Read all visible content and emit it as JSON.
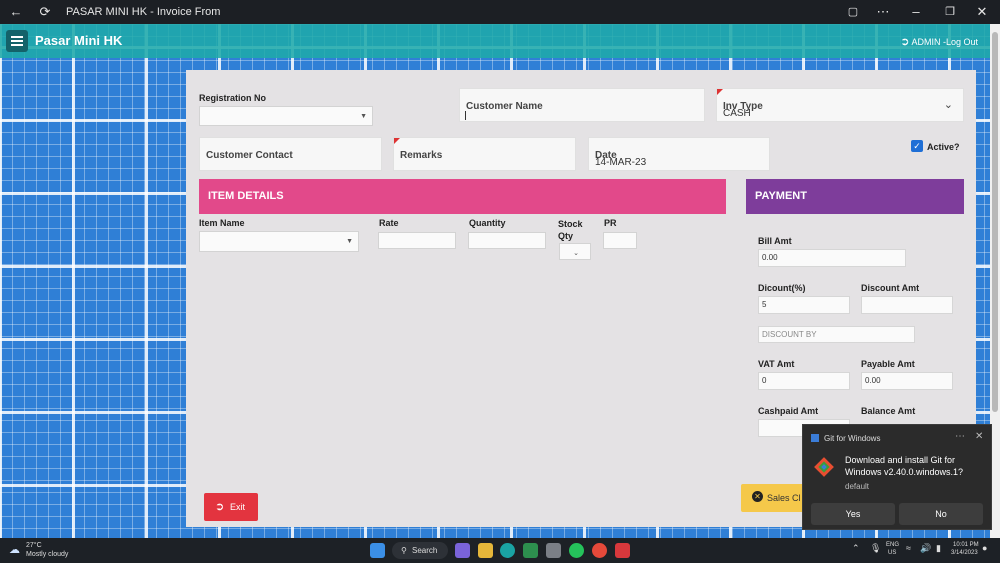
{
  "window": {
    "title": "PASAR MINI HK - Invoice From"
  },
  "appbar": {
    "title": "Pasar Mini HK",
    "user": "ADMIN -Log Out"
  },
  "form": {
    "registration_label": "Registration No",
    "customer_name_label": "Customer Name",
    "inv_type_label": "Inv Type",
    "inv_type_value": "CASH",
    "customer_contact_label": "Customer Contact",
    "remarks_label": "Remarks",
    "date_label": "Date",
    "date_value": "14-MAR-23",
    "active_label": "Active?"
  },
  "items": {
    "header": "ITEM DETAILS",
    "item_name_label": "Item Name",
    "rate_label": "Rate",
    "quantity_label": "Quantity",
    "stock_qty_label": "Stock Qty",
    "pr_label": "PR"
  },
  "payment": {
    "header": "PAYMENT",
    "bill_amt_label": "Bill Amt",
    "bill_amt_value": "0.00",
    "discount_pct_label": "Dicount(%)",
    "discount_pct_value": "5",
    "discount_amt_label": "Discount Amt",
    "discount_by_placeholder": "DISCOUNT BY",
    "vat_amt_label": "VAT Amt",
    "vat_amt_value": "0",
    "payable_amt_label": "Payable Amt",
    "payable_amt_value": "0.00",
    "cashpaid_label": "Cashpaid Amt",
    "balance_label": "Balance Amt"
  },
  "buttons": {
    "exit": "Exit",
    "sales": "Sales Cl"
  },
  "toast": {
    "app": "Git for Windows",
    "message": "Download and install Git for Windows v2.40.0.windows.1?",
    "sub": "default",
    "yes": "Yes",
    "no": "No"
  },
  "taskbar": {
    "weather_temp": "27°C",
    "weather_desc": "Mostly cloudy",
    "search": "Search",
    "lang1": "ENG",
    "lang2": "US",
    "time": "10:01 PM",
    "date": "3/14/2023"
  },
  "colors": {
    "teal": "#1faaaa",
    "item_header": "#e2498a",
    "payment_header": "#7e3d9b",
    "exit": "#e3343f",
    "sales": "#f5c84a"
  }
}
